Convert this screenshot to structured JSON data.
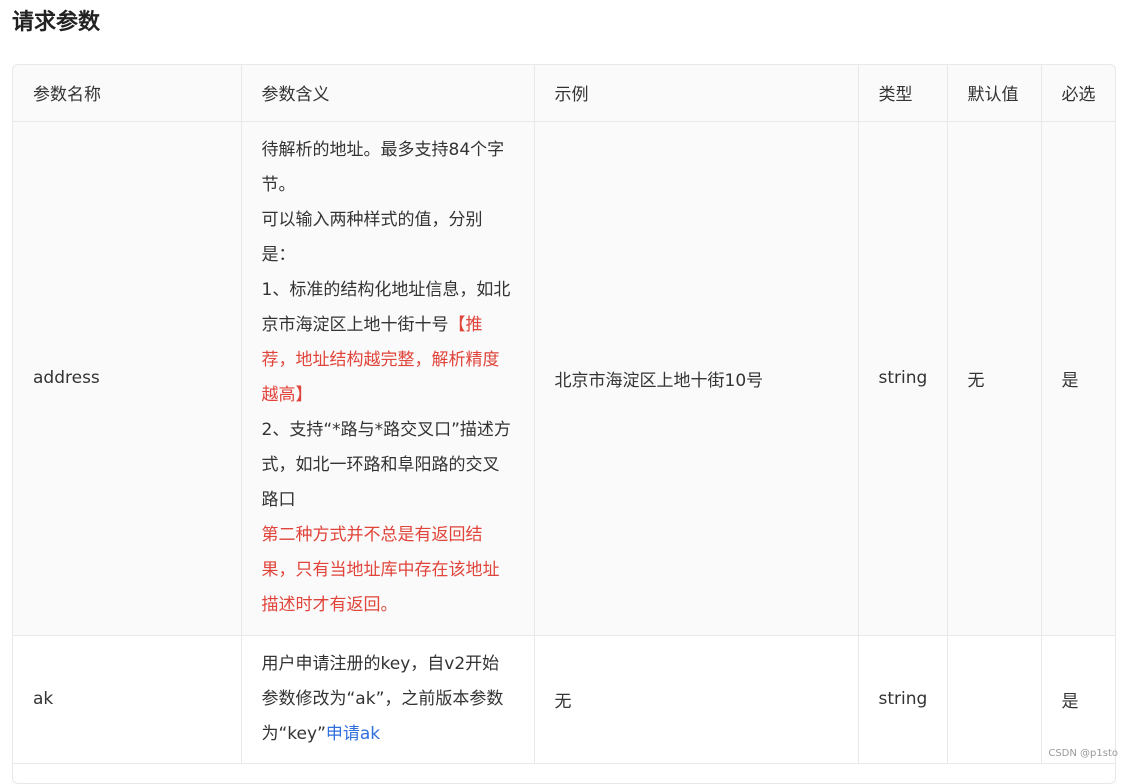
{
  "page": {
    "title": "请求参数",
    "watermark": "CSDN @p1sto"
  },
  "table": {
    "headers": [
      "参数名称",
      "参数含义",
      "示例",
      "类型",
      "默认值",
      "必选"
    ],
    "rows": [
      {
        "name": "address",
        "meaning": {
          "line1": "待解析的地址。最多支持84个字节。",
          "line2": "可以输入两种样式的值，分别是：",
          "line3_plain": "1、标准的结构化地址信息，如北京市海淀区上地十街十号",
          "line3_red": "【推荐，地址结构越完整，解析精度越高】",
          "line4": "2、支持“*路与*路交叉口”描述方式，如北一环路和阜阳路的交叉路口",
          "line5_red": "第二种方式并不总是有返回结果，只有当地址库中存在该地址描述时才有返回。"
        },
        "example": "北京市海淀区上地十街10号",
        "type": "string",
        "default": "无",
        "required": "是"
      },
      {
        "name": "ak",
        "meaning": {
          "text": "用户申请注册的key，自v2开始参数修改为“ak”，之前版本参数为“key”",
          "link": "申请ak"
        },
        "example": "无",
        "type": "string",
        "default": "",
        "required": "是"
      }
    ]
  },
  "colors": {
    "highlight_red": "#e0443a",
    "link_blue": "#2f6fde"
  }
}
